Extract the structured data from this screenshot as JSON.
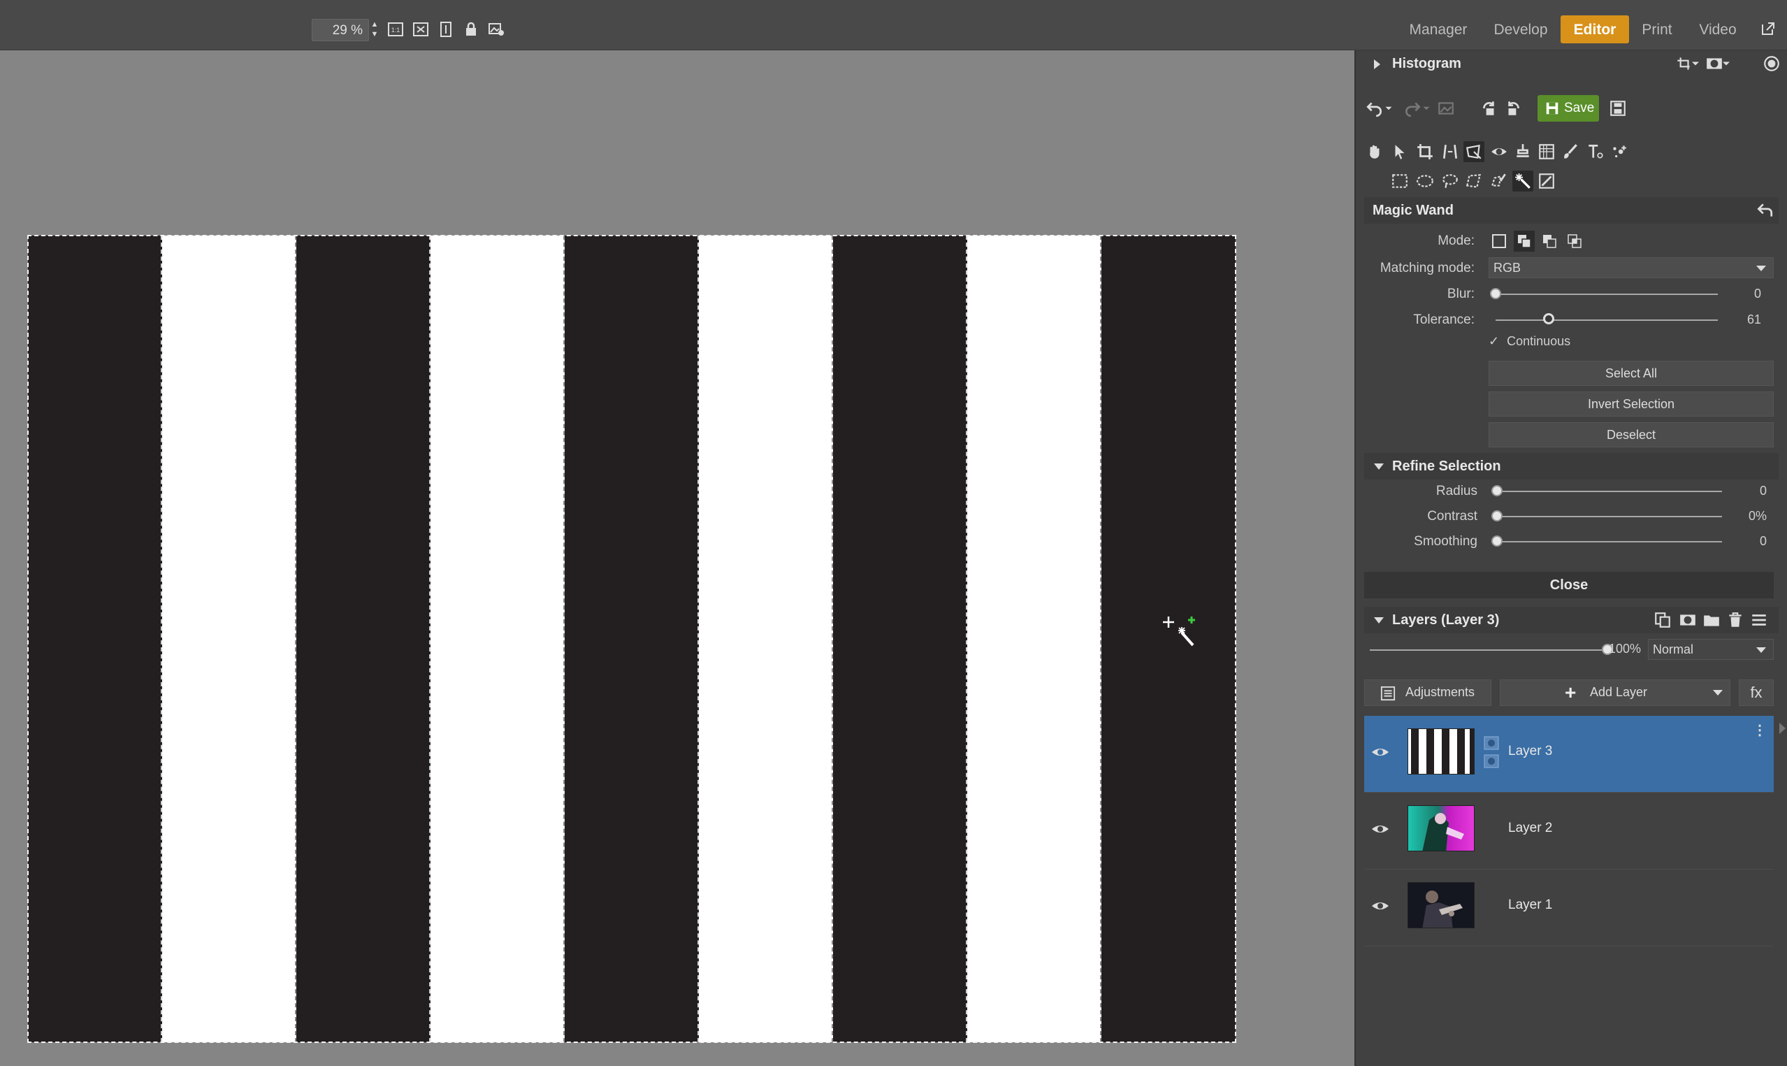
{
  "topbar": {
    "zoom_value": "29 %",
    "tool_icons": [
      "actual-size-icon",
      "fit-screen-icon",
      "fit-height-icon",
      "lock-icon",
      "view-settings-icon"
    ],
    "modules": [
      {
        "label": "Manager"
      },
      {
        "label": "Develop"
      },
      {
        "label": "Editor",
        "active": true
      },
      {
        "label": "Print"
      },
      {
        "label": "Video"
      }
    ]
  },
  "canvas": {
    "stripes": [
      "dark",
      "light",
      "dark",
      "light",
      "dark",
      "light",
      "dark",
      "light",
      "dark"
    ],
    "colors": {
      "dark": "#231f20",
      "light": "#ffffff"
    }
  },
  "panel": {
    "histogram_title": "Histogram",
    "save_label": "Save",
    "tool_title": "Magic Wand",
    "mode_label": "Mode:",
    "matching_label": "Matching mode:",
    "matching_value": "RGB",
    "blur_label": "Blur:",
    "blur_value": "0",
    "blur_level": 0,
    "tolerance_label": "Tolerance:",
    "tolerance_value": "61",
    "tolerance_level": 0.24,
    "continuous_label": "Continuous",
    "continuous_checked": true,
    "select_all": "Select All",
    "invert_selection": "Invert Selection",
    "deselect": "Deselect",
    "refine_title": "Refine Selection",
    "radius_label": "Radius",
    "radius_value": "0",
    "contrast_label": "Contrast",
    "contrast_value": "0%",
    "smoothing_label": "Smoothing",
    "smoothing_value": "0",
    "close_label": "Close",
    "layers_title": "Layers (Layer 3)",
    "opacity_value": "100%",
    "opacity_level": 1.0,
    "blend_mode": "Normal",
    "adjustments_label": "Adjustments",
    "add_layer_label": "Add Layer",
    "fx_label": "fx",
    "layers": [
      {
        "name": "Layer 3",
        "active": true
      },
      {
        "name": "Layer 2",
        "active": false
      },
      {
        "name": "Layer 1",
        "active": false
      }
    ],
    "accent": "#d8921a",
    "selection_color": "#3a6ea5",
    "save_color": "#5a8f2a"
  }
}
